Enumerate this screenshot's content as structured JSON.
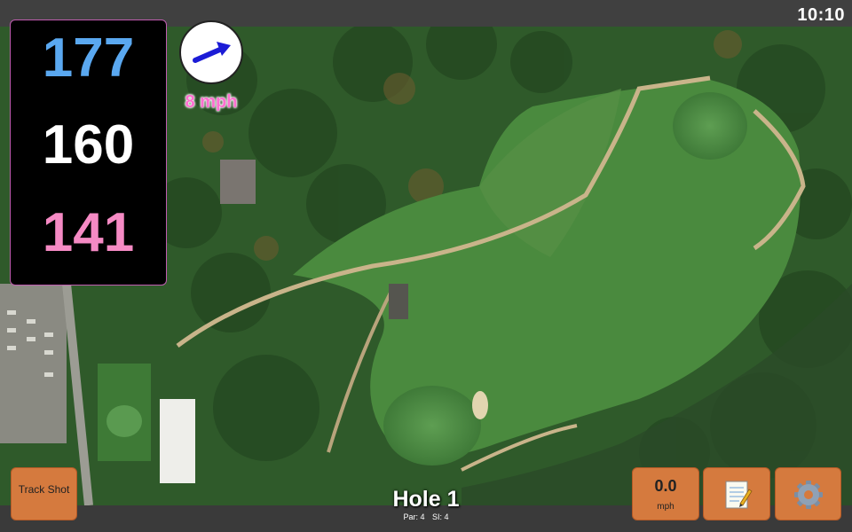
{
  "status": {
    "time": "10:10"
  },
  "yardages": {
    "back": "177",
    "middle": "160",
    "front": "141"
  },
  "wind": {
    "speed_label": "8 mph",
    "icon": "wind-arrow-icon"
  },
  "hole": {
    "title": "Hole 1",
    "par_label": "Par: 4",
    "si_label": "SI: 4"
  },
  "buttons": {
    "track_shot": "Track Shot",
    "speed_value": "0.0",
    "speed_unit": "mph",
    "notes_icon": "notepad-icon",
    "settings_icon": "gear-icon"
  },
  "colors": {
    "back_yardage": "#5aa8f0",
    "middle_yardage": "#ffffff",
    "front_yardage": "#f58ac4",
    "wind_speed": "#ff6fd0",
    "button_bg": "#d57a3e"
  }
}
